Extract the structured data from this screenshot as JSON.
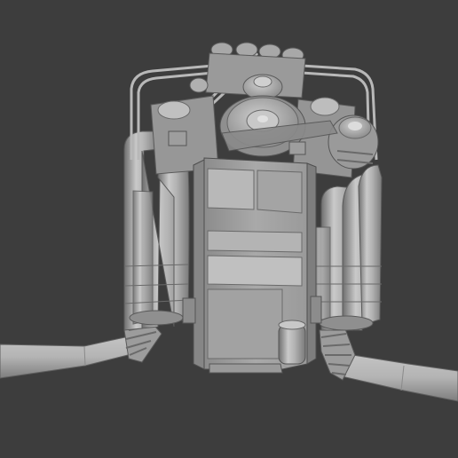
{
  "scene": {
    "subject": "engine-3d-model",
    "background_color": "#3d3d3d",
    "model_color": "#a6a6a6",
    "highlight_color": "#d2d2d2",
    "shadow_color": "#6e6e6e"
  }
}
